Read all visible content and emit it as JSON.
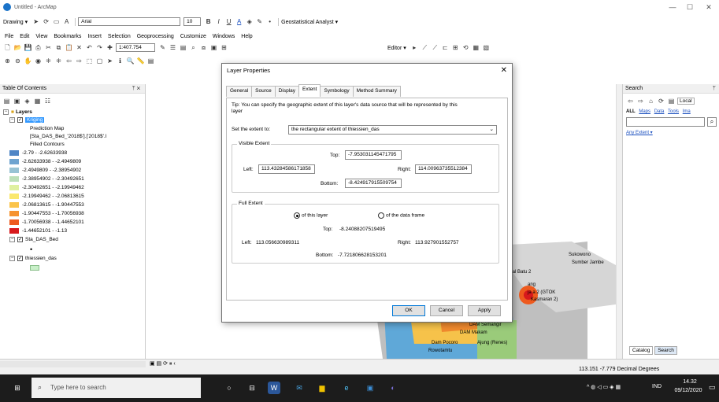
{
  "window": {
    "title": "Untitled - ArcMap",
    "minimize": "—",
    "maximize": "☐",
    "close": "✕"
  },
  "drawing_toolbar": {
    "drawing_label": "Drawing ▾",
    "font_name": "Arial",
    "font_size": "10",
    "bold": "B",
    "italic": "I",
    "underline": "U",
    "font_color": "A",
    "geostat_label": "Geostatistical Analyst ▾"
  },
  "menu": [
    "File",
    "Edit",
    "View",
    "Bookmarks",
    "Insert",
    "Selection",
    "Geoprocessing",
    "Customize",
    "Windows",
    "Help"
  ],
  "standard_toolbar": {
    "scale": "1:407.754",
    "editor_label": "Editor ▾"
  },
  "toc": {
    "title": "Table Of Contents",
    "pin": "ᛘ ✕",
    "layers_label": "Layers",
    "kriging_label": "Kriging",
    "prediction_map": "Prediction Map",
    "field_expr": "[Sta_DAS_Bed_'2018$'].['2018$'.l",
    "filled_contours": "Filled Contours",
    "legend": [
      {
        "label": "-2.79 - -2.62633938",
        "color": "#4f86c6"
      },
      {
        "label": "-2.62633938 - -2.4949809",
        "color": "#6fa4d0"
      },
      {
        "label": "-2.4949809 - -2.38954902",
        "color": "#98c3d4"
      },
      {
        "label": "-2.38954902 - -2.30492651",
        "color": "#bcdfb8"
      },
      {
        "label": "-2.30492651 - -2.19949462",
        "color": "#dff0a0"
      },
      {
        "label": "-2.19949462 - -2.06813615",
        "color": "#fae86c"
      },
      {
        "label": "-2.06813615 - -1.90447553",
        "color": "#fbc44a"
      },
      {
        "label": "-1.90447553 - -1.70056938",
        "color": "#f6922e"
      },
      {
        "label": "-1.70056938 - -1.44652101",
        "color": "#ee5a1e"
      },
      {
        "label": "-1.44652101 - -1.13",
        "color": "#d7191c"
      }
    ],
    "sta_das_bed": "Sta_DAS_Bed",
    "thiessien_das": "thiessien_das"
  },
  "dialog": {
    "title": "Layer Properties",
    "close": "✕",
    "tabs": [
      "General",
      "Source",
      "Display",
      "Extent",
      "Symbology",
      "Method Summary"
    ],
    "active_tab": "Extent",
    "tip": "Tip: You can specify the geographic extent of this layer's data source that will be represented by this layer",
    "set_extent_label": "Set the extent to:",
    "set_extent_value": "the rectangular extent of thiessien_das",
    "visible_extent": {
      "legend": "Visible Extent",
      "top_label": "Top:",
      "top": "-7.953031145471795",
      "left_label": "Left:",
      "left": "113.43284586171858",
      "right_label": "Right:",
      "right": "114.00963735512384",
      "bottom_label": "Bottom:",
      "bottom": "-8.424917915509754"
    },
    "full_extent": {
      "legend": "Full Extent",
      "opt_layer": "of this layer",
      "opt_frame": "of the data frame",
      "top_label": "Top:",
      "top": "-8.24088207519495",
      "left_label": "Left:",
      "left": "113.056630989311",
      "right_label": "Right:",
      "right": "113.927901552757",
      "bottom_label": "Bottom:",
      "bottom": "-7.721806628153201"
    },
    "ok": "OK",
    "cancel": "Cancel",
    "apply": "Apply"
  },
  "map_labels": [
    "Sukowono",
    "Sumber Jambe",
    "Tegal Batu 2",
    "ang",
    "ja a 2 (GTOK",
    "Kasmaran 2)",
    "DAM Semangir",
    "DAM Makam",
    "Dam Pocoro",
    "Ajung (Renes)",
    "Rowotamtu"
  ],
  "search_panel": {
    "title": "Search",
    "local": "Local",
    "filters": [
      "ALL",
      "Maps",
      "Data",
      "Tools",
      "Ima"
    ],
    "any_extent": "Any Extent ▾",
    "catalog_tab": "Catalog",
    "search_tab": "Search"
  },
  "status_bar": {
    "coords": "113.151 -7.779 Decimal Degrees"
  },
  "taskbar": {
    "search_placeholder": "Type here to search",
    "lang": "IND",
    "time": "14.32",
    "date": "09/12/2020"
  }
}
